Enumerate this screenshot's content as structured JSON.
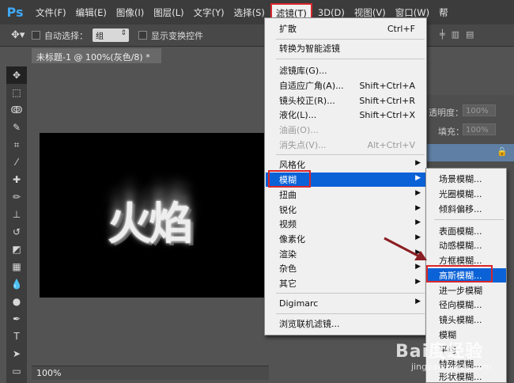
{
  "app": {
    "logo": "Ps"
  },
  "menubar": {
    "items": [
      "文件(F)",
      "编辑(E)",
      "图像(I)",
      "图层(L)",
      "文字(Y)",
      "选择(S)",
      "滤镜(T)",
      "3D(D)",
      "视图(V)",
      "窗口(W)",
      "帮"
    ],
    "active_index": 6
  },
  "options_bar": {
    "auto_select_label": "自动选择：",
    "auto_select_value": "组",
    "show_transform_label": "显示变换控件"
  },
  "document": {
    "tab_title": "未标题-1 @ 100%(灰色/8) *",
    "canvas_text": "火焰",
    "zoom": "100%"
  },
  "right_panel": {
    "opacity_label": "透明度：",
    "opacity_value": "100%",
    "fill_label": "填充：",
    "fill_value": "100%"
  },
  "filter_menu": {
    "items": [
      {
        "label": "扩散",
        "shortcut": "Ctrl+F",
        "disabled": false
      },
      {
        "label": "转换为智能滤镜",
        "shortcut": "",
        "disabled": false
      },
      {
        "label": "滤镜库(G)...",
        "shortcut": "",
        "disabled": false
      },
      {
        "label": "自适应广角(A)...",
        "shortcut": "Shift+Ctrl+A",
        "disabled": false
      },
      {
        "label": "镜头校正(R)...",
        "shortcut": "Shift+Ctrl+R",
        "disabled": false
      },
      {
        "label": "液化(L)...",
        "shortcut": "Shift+Ctrl+X",
        "disabled": false
      },
      {
        "label": "油画(O)...",
        "shortcut": "",
        "disabled": true
      },
      {
        "label": "消失点(V)...",
        "shortcut": "Alt+Ctrl+V",
        "disabled": true
      },
      {
        "label": "风格化",
        "submenu": true
      },
      {
        "label": "模糊",
        "submenu": true,
        "highlighted": true
      },
      {
        "label": "扭曲",
        "submenu": true
      },
      {
        "label": "锐化",
        "submenu": true
      },
      {
        "label": "视频",
        "submenu": true
      },
      {
        "label": "像素化",
        "submenu": true
      },
      {
        "label": "渲染",
        "submenu": true
      },
      {
        "label": "杂色",
        "submenu": true
      },
      {
        "label": "其它",
        "submenu": true
      },
      {
        "label": "Digimarc",
        "submenu": true
      },
      {
        "label": "浏览联机滤镜...",
        "shortcut": ""
      }
    ]
  },
  "blur_submenu": {
    "items": [
      "场景模糊...",
      "光圈模糊...",
      "倾斜偏移...",
      "表面模糊...",
      "动感模糊...",
      "方框模糊...",
      "高斯模糊...",
      "进一步模糊",
      "径向模糊...",
      "镜头模糊...",
      "模糊",
      "平均",
      "特殊模糊...",
      "形状模糊..."
    ],
    "highlighted_index": 6
  },
  "watermark": {
    "brand": "Bai度经验",
    "url": "jingyan.baidu.com"
  },
  "colors": {
    "highlight": "#0b62d7",
    "annotation": "#d9262b",
    "menubar_bg": "#3c3c3c"
  }
}
